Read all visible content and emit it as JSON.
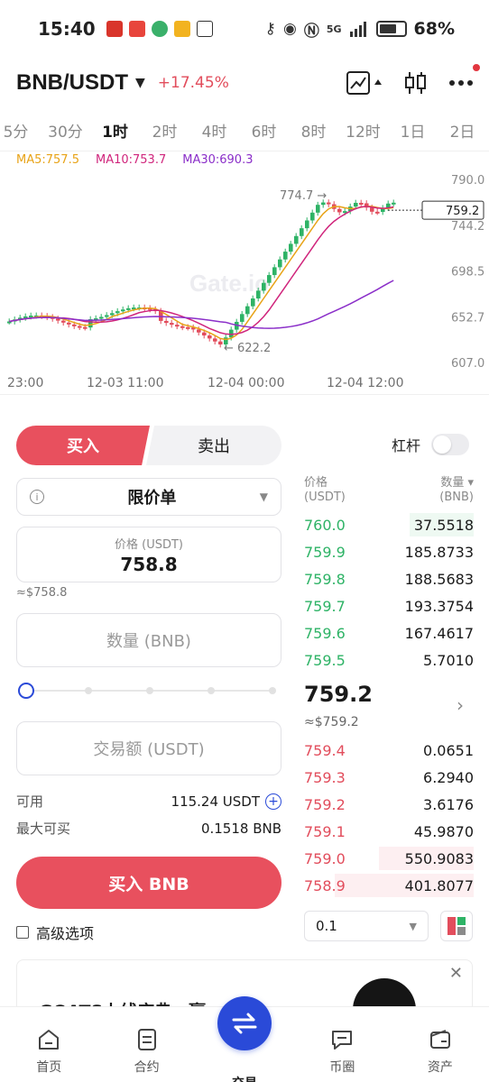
{
  "status_bar": {
    "time": "15:40",
    "network": "5G",
    "battery": "68%",
    "icons": [
      "key-icon",
      "eye-icon",
      "nfc-icon",
      "signal-icon",
      "battery-icon"
    ]
  },
  "header": {
    "pair": "BNB/USDT",
    "change": "+17.45%",
    "icons": [
      "chart-line-icon",
      "candlestick-icon",
      "more-icon"
    ]
  },
  "timeframes": [
    "5分",
    "30分",
    "1时",
    "2时",
    "4时",
    "6时",
    "8时",
    "12时",
    "1日",
    "2日"
  ],
  "active_timeframe": "1时",
  "ma": {
    "ma5": "MA5:757.5",
    "ma10": "MA10:753.7",
    "ma30": "MA30:690.3"
  },
  "chart_data": {
    "type": "candlestick",
    "y_ticks": [
      "790.0",
      "744.2",
      "698.5",
      "652.7",
      "607.0"
    ],
    "ylim": [
      607.0,
      790.0
    ],
    "x_ticks": [
      "23:00",
      "12-03 11:00",
      "12-04 00:00",
      "12-04 12:00"
    ],
    "current_price_tag": "759.2",
    "high_label": "774.7 →",
    "low_label": "← 622.2",
    "watermark": "Gate.io"
  },
  "trade": {
    "buy_tab": "买入",
    "sell_tab": "卖出",
    "leverage_label": "杠杆",
    "order_type": "限价单",
    "price_label": "价格 (USDT)",
    "price_value": "758.8",
    "price_approx": "≈$758.8",
    "qty_placeholder": "数量 (BNB)",
    "amount_placeholder": "交易额 (USDT)",
    "available_label": "可用",
    "available_value": "115.24 USDT",
    "max_buy_label": "最大可买",
    "max_buy_value": "0.1518 BNB",
    "buy_button": "买入 BNB",
    "advanced_label": "高级选项"
  },
  "orderbook": {
    "price_header_1": "价格",
    "price_header_2": "(USDT)",
    "qty_header_1": "数量 ▾",
    "qty_header_2": "(BNB)",
    "asks": [
      {
        "price": "760.0",
        "qty": "37.5518",
        "depth": 0.38
      },
      {
        "price": "759.9",
        "qty": "185.8733",
        "depth": 0
      },
      {
        "price": "759.8",
        "qty": "188.5683",
        "depth": 0
      },
      {
        "price": "759.7",
        "qty": "193.3754",
        "depth": 0
      },
      {
        "price": "759.6",
        "qty": "167.4617",
        "depth": 0
      },
      {
        "price": "759.5",
        "qty": "5.7010",
        "depth": 0
      }
    ],
    "last_price": "759.2",
    "last_price_approx": "≈$759.2",
    "bids": [
      {
        "price": "759.4",
        "qty": "0.0651",
        "depth": 0
      },
      {
        "price": "759.3",
        "qty": "6.2940",
        "depth": 0
      },
      {
        "price": "759.2",
        "qty": "3.6176",
        "depth": 0
      },
      {
        "price": "759.1",
        "qty": "45.9870",
        "depth": 0
      },
      {
        "price": "759.0",
        "qty": "550.9083",
        "depth": 0.56
      },
      {
        "price": "758.9",
        "qty": "401.8077",
        "depth": 0.82
      }
    ],
    "precision": "0.1"
  },
  "banner": {
    "text": "GOATS上线庆典，赢..."
  },
  "bottom_nav": [
    {
      "label": "首页",
      "icon": "home-icon"
    },
    {
      "label": "合约",
      "icon": "contract-icon"
    },
    {
      "label": "交易",
      "icon": "swap-icon"
    },
    {
      "label": "币圈",
      "icon": "chat-icon"
    },
    {
      "label": "资产",
      "icon": "wallet-icon"
    }
  ],
  "colors": {
    "buy": "#e8505e",
    "ask_green": "#2eb366",
    "bid_red": "#e24d5c",
    "accent_blue": "#2a4ad8",
    "ma5": "#e8a317",
    "ma10": "#d0257c",
    "ma30": "#8b2fc9"
  }
}
